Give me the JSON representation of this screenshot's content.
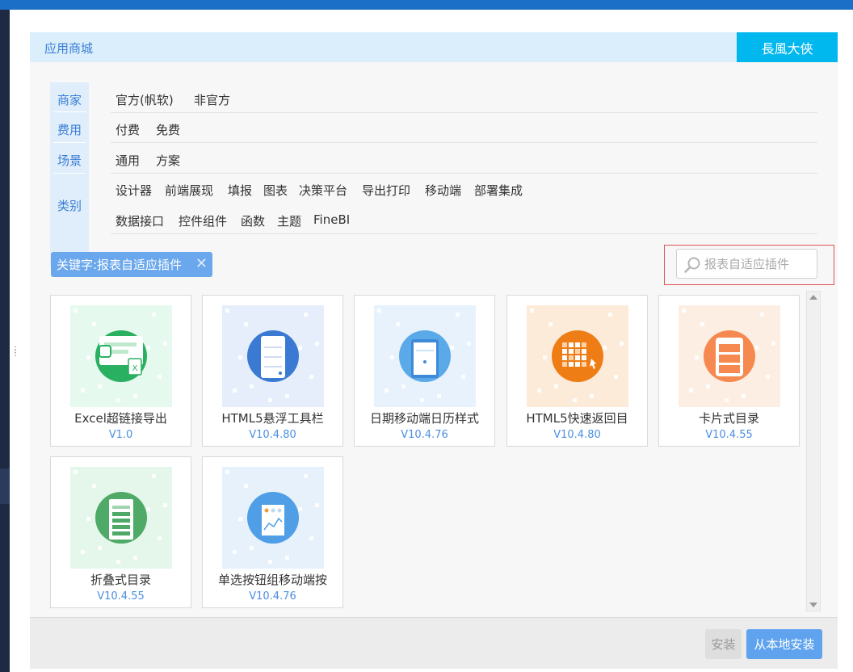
{
  "dialog": {
    "title": "应用商城",
    "user": "長風大俠"
  },
  "filters": {
    "labels": [
      "商家",
      "费用",
      "场景",
      "类别"
    ],
    "merchant": [
      "官方(帆软)",
      "非官方"
    ],
    "fee": [
      "付费",
      "免费"
    ],
    "scene": [
      "通用",
      "方案"
    ],
    "category_row1": [
      "设计器",
      "前端展现",
      "填报",
      "图表",
      "决策平台",
      "导出打印",
      "移动端",
      "部署集成"
    ],
    "category_row2": [
      "数据接口",
      "控件组件",
      "函数",
      "主题",
      "FineBI"
    ]
  },
  "keyword_tag": "关键字:报表自适应插件",
  "search": {
    "placeholder": "报表自适应插件"
  },
  "plugins": [
    {
      "name": "Excel超链接导出",
      "version": "V1.0",
      "theme": "#29b061",
      "bg": "#e6f9ee",
      "icon": "excel-link-icon"
    },
    {
      "name": "HTML5悬浮工具栏",
      "version": "V10.4.80",
      "theme": "#3b7ad3",
      "bg": "#e6eefb",
      "icon": "toolbar-icon"
    },
    {
      "name": "日期移动端日历样式",
      "version": "V10.4.76",
      "theme": "#5aa9e8",
      "bg": "#e7f2fc",
      "icon": "calendar-icon"
    },
    {
      "name": "HTML5快速返回目",
      "version": "V10.4.80",
      "theme": "#ef7d16",
      "bg": "#fdebd9",
      "icon": "grid-return-icon"
    },
    {
      "name": "卡片式目录",
      "version": "V10.4.55",
      "theme": "#f5894f",
      "bg": "#fdeee3",
      "icon": "card-catalog-icon"
    },
    {
      "name": "折叠式目录",
      "version": "V10.4.55",
      "theme": "#4faa67",
      "bg": "#e4f7ea",
      "icon": "fold-catalog-icon"
    },
    {
      "name": "单选按钮组移动端按",
      "version": "V10.4.76",
      "theme": "#4f9ee6",
      "bg": "#e6f1fc",
      "icon": "mobile-radio-icon"
    }
  ],
  "footer": {
    "install_label": "安装",
    "local_install_label": "从本地安装"
  }
}
